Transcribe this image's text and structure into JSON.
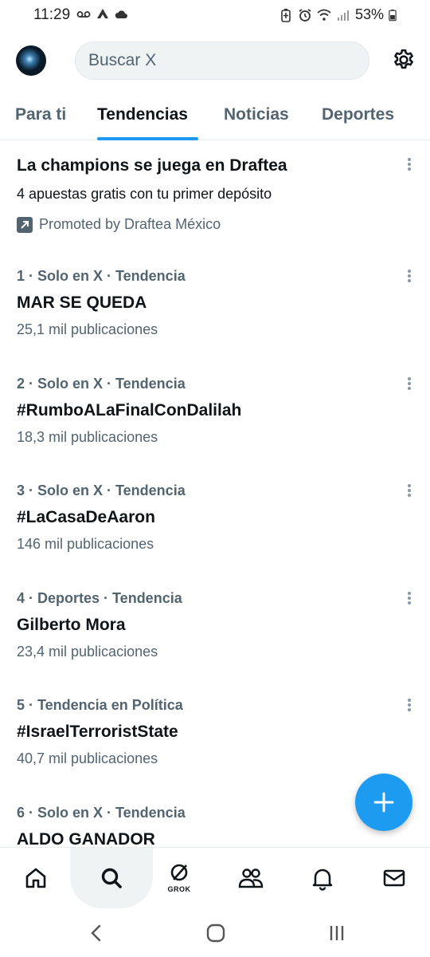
{
  "status_bar": {
    "time": "11:29",
    "battery": "53%",
    "left_icons": [
      "voicemail-icon",
      "app-icon",
      "cloud-icon"
    ],
    "right_icons": [
      "battery-saver-icon",
      "alarm-icon",
      "wifi-icon",
      "signal-icon",
      "battery-icon"
    ]
  },
  "header": {
    "search_placeholder": "Buscar X",
    "avatar": "avatar",
    "settings_icon": "gear-icon"
  },
  "tabs": [
    {
      "label": "Para ti",
      "active": false
    },
    {
      "label": "Tendencias",
      "active": true
    },
    {
      "label": "Noticias",
      "active": false
    },
    {
      "label": "Deportes",
      "active": false
    }
  ],
  "promo": {
    "title": "La champions se juega en Draftea",
    "description": "4 apuestas gratis con tu primer depósito",
    "promoted_by": "Promoted by Draftea México"
  },
  "trends": [
    {
      "meta": "1 · Solo en X · Tendencia",
      "title": "MAR SE QUEDA",
      "count": "25,1 mil publicaciones"
    },
    {
      "meta": "2 · Solo en X · Tendencia",
      "title": "#RumboALaFinalConDalilah",
      "count": "18,3 mil publicaciones"
    },
    {
      "meta": "3 · Solo en X · Tendencia",
      "title": "#LaCasaDeAaron",
      "count": "146 mil publicaciones"
    },
    {
      "meta": "4 · Deportes · Tendencia",
      "title": "Gilberto Mora",
      "count": "23,4 mil publicaciones"
    },
    {
      "meta": "5 · Tendencia en Política",
      "title": "#IsraelTerroristState",
      "count": "40,7 mil publicaciones"
    },
    {
      "meta": "6 · Solo en X · Tendencia",
      "title": "ALDO GANADOR",
      "count": ""
    }
  ],
  "fab": {
    "icon": "plus-icon"
  },
  "bottom_nav": {
    "items": [
      "home-icon",
      "search-icon",
      "grok-icon",
      "communities-icon",
      "notifications-icon",
      "messages-icon"
    ],
    "grok_label": "GROK"
  },
  "system_nav": [
    "back-icon",
    "home-circle-icon",
    "recents-icon"
  ],
  "colors": {
    "accent": "#1d9bf0",
    "text": "#0f1419",
    "secondary": "#536471"
  }
}
